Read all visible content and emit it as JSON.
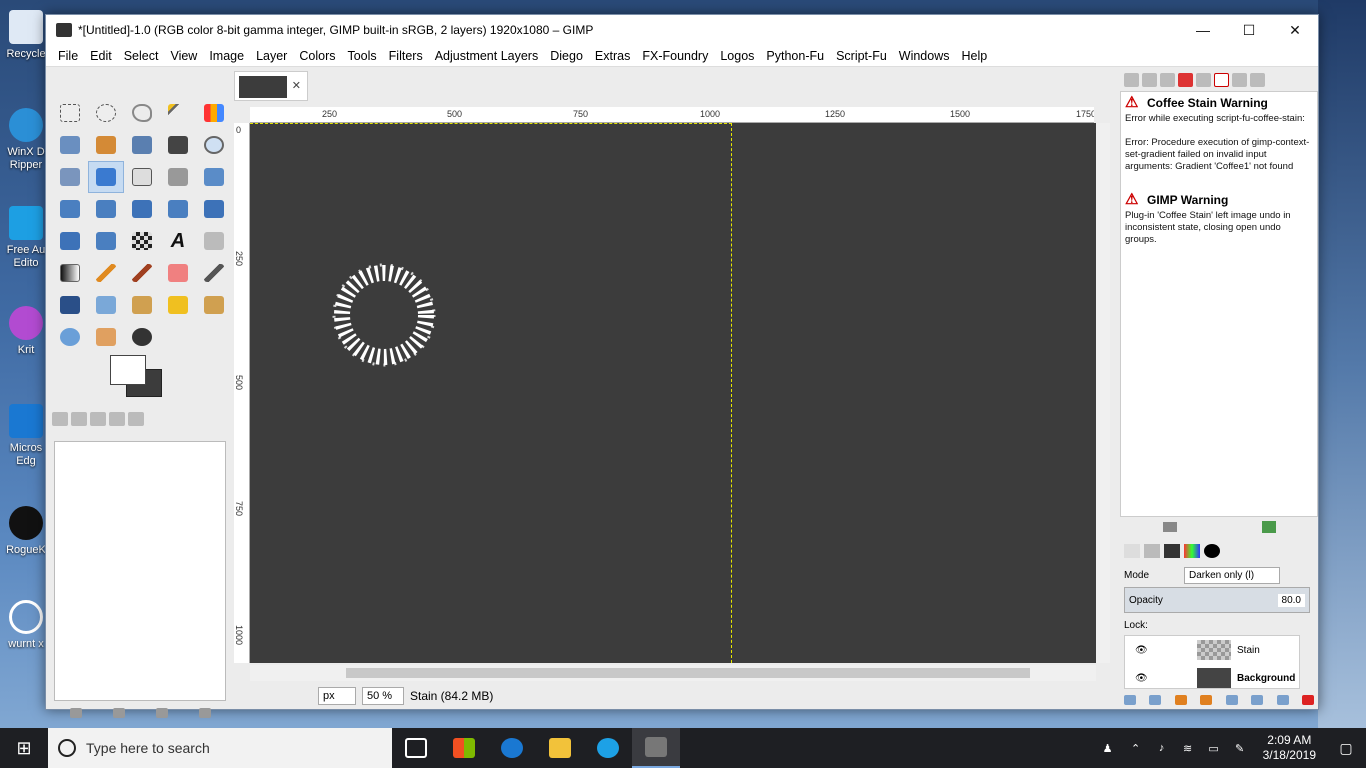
{
  "window": {
    "title": "*[Untitled]-1.0 (RGB color 8-bit gamma integer, GIMP built-in sRGB, 2 layers) 1920x1080 – GIMP",
    "controls": {
      "minimize": "—",
      "maximize": "☐",
      "close": "✕"
    }
  },
  "menu": [
    "File",
    "Edit",
    "Select",
    "View",
    "Image",
    "Layer",
    "Colors",
    "Tools",
    "Filters",
    "Adjustment Layers",
    "Diego",
    "Extras",
    "FX-Foundry",
    "Logos",
    "Python-Fu",
    "Script-Fu",
    "Windows",
    "Help"
  ],
  "desktop": {
    "icons": [
      "Recycle",
      "WinX D Ripper",
      "Free Au Edito",
      "Krit",
      "Micros Edg",
      "RogueK",
      "wurnt x"
    ]
  },
  "rulers": {
    "h": [
      "250",
      "500",
      "750",
      "1000",
      "1250",
      "1500",
      "1750"
    ],
    "v": [
      "0",
      "250",
      "500",
      "750",
      "1000"
    ]
  },
  "status": {
    "unit": "px",
    "zoom": "50 %",
    "layer_info": "Stain (84.2 MB)"
  },
  "messages": [
    {
      "title": "Coffee Stain Warning",
      "lines": [
        "Error while executing script-fu-coffee-stain:",
        "",
        "Error: Procedure execution of gimp-context-set-gradient failed on invalid input arguments: Gradient 'Coffee1' not found"
      ]
    },
    {
      "title": "GIMP Warning",
      "lines": [
        "Plug-in 'Coffee Stain' left image undo in inconsistent state, closing open undo groups."
      ]
    }
  ],
  "layers_panel": {
    "mode_label": "Mode",
    "mode_value": "Darken only (l)",
    "opacity_label": "Opacity",
    "opacity_value": "80.0",
    "lock_label": "Lock:",
    "layers": [
      "Stain",
      "Background"
    ]
  },
  "taskbar": {
    "search_placeholder": "Type here to search",
    "time": "2:09 AM",
    "date": "3/18/2019"
  },
  "colors": {
    "canvas": "#3c3c3c",
    "warning": "#cc0000",
    "taskbar": "#1e1f23"
  }
}
